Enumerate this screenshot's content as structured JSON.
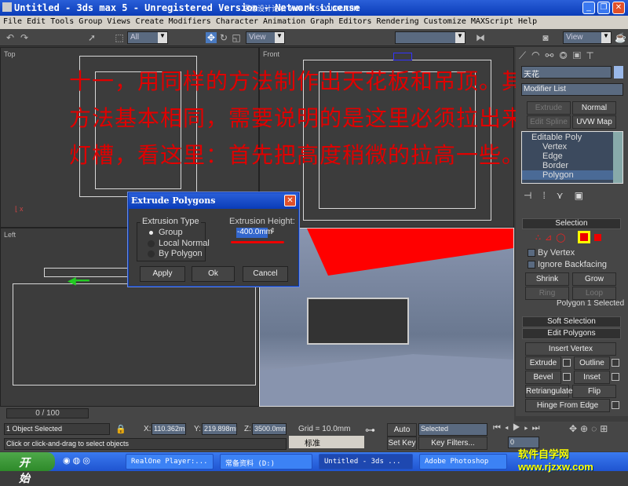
{
  "window": {
    "title": "Untitled - 3ds max 5 - Unregistered Version - Network License",
    "watermark": "思缘设计论坛 WWW.MISSYUAN.COM"
  },
  "menu": [
    "File",
    "Edit",
    "Tools",
    "Group",
    "Views",
    "Create",
    "Modifiers",
    "Character",
    "Animation",
    "Graph Editors",
    "Rendering",
    "Customize",
    "MAXScript",
    "Help"
  ],
  "toolbar": {
    "selection_filter": "All",
    "ref_coord": "View",
    "named_sel": "",
    "view2": "View"
  },
  "viewports": {
    "top": "Top",
    "front": "Front",
    "left": "Left",
    "persp": ""
  },
  "annotation": [
    "十一，用同样的方法制作出天花板和吊顶。其",
    "方法基本相同，需要说明的是这里必须拉出来",
    "灯槽，看这里：首先把高度稍微的拉高一些。"
  ],
  "dialog": {
    "title": "Extrude Polygons",
    "type_label": "Extrusion Type",
    "options": [
      "Group",
      "Local Normal",
      "By Polygon"
    ],
    "selected": "Group",
    "height_label": "Extrusion Height:",
    "height_value": "-400.0mm",
    "apply": "Apply",
    "ok": "Ok",
    "cancel": "Cancel"
  },
  "panel": {
    "object_name": "天花",
    "modifier_list": "Modifier List",
    "buttons": [
      "Extrude",
      "Normal",
      "Edit Spline",
      "UVW Map"
    ],
    "stack": [
      "Editable Poly",
      "Vertex",
      "Edge",
      "Border",
      "Polygon"
    ],
    "stack_selected": "Polygon",
    "selection": {
      "title": "Selection",
      "by_vertex": "By Vertex",
      "ignore_backfacing": "Ignore Backfacing",
      "shrink": "Shrink",
      "grow": "Grow",
      "ring": "Ring",
      "loop": "Loop",
      "status": "Polygon 1 Selected"
    },
    "soft_selection": "Soft Selection",
    "edit_polygons": {
      "title": "Edit Polygons",
      "insert_vertex": "Insert Vertex",
      "extrude": "Extrude",
      "outline": "Outline",
      "bevel": "Bevel",
      "inset": "Inset",
      "retriangulate": "Retriangulate",
      "flip": "Flip",
      "hinge": "Hinge From Edge"
    }
  },
  "timeline": {
    "frame": "0 / 100"
  },
  "status": {
    "selected": "1 Object Selected",
    "prompt": "Click or click-and-drag to select objects",
    "x": "110.362mm",
    "y": "219.898mm",
    "z": "3500.0mm",
    "grid": "Grid = 10.0mm",
    "auto_key": "Auto Key",
    "set_key": "Set Key",
    "key_mode": "Selected",
    "key_filters": "Key Filters...",
    "current_frame": "0",
    "ime": "标准"
  },
  "taskbar": {
    "start": "开始",
    "tasks": [
      "RealOne Player:...",
      "常备资料 (D:)",
      "Untitled - 3ds ...",
      "Adobe Photoshop"
    ],
    "active": "Untitled - 3ds ...",
    "logo": "软件自学网 www.rjzxw.com"
  },
  "colors": {
    "accent": "#ff0000",
    "titlebar": "#0a3cb8",
    "selection_highlight": "#ffff00"
  }
}
